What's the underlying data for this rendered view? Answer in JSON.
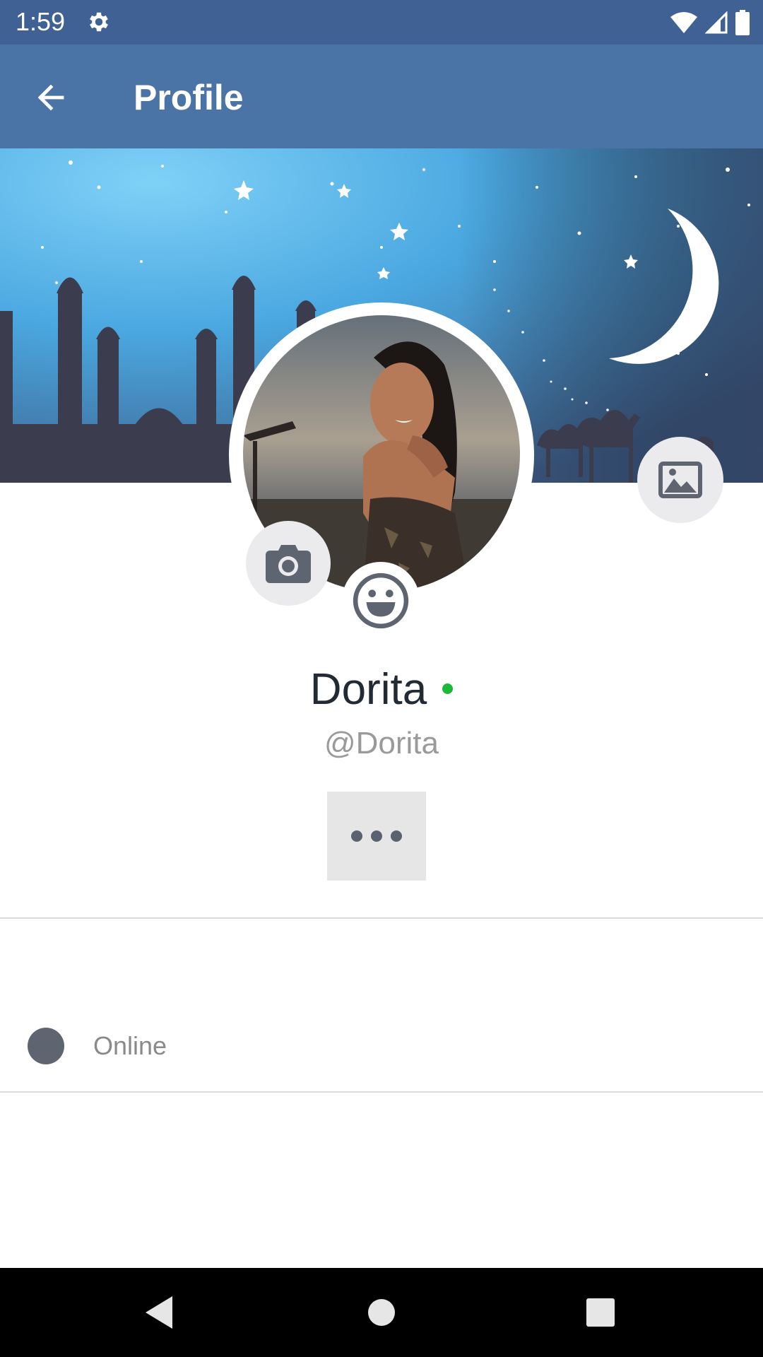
{
  "status_bar": {
    "time": "1:59",
    "icons": [
      "gear-icon",
      "wifi-icon",
      "signal-icon",
      "battery-icon"
    ]
  },
  "app_bar": {
    "title": "Profile",
    "back_icon": "arrow-left-icon"
  },
  "profile": {
    "display_name": "Dorita",
    "username": "@Dorita",
    "presence_color": "#1cb83a",
    "more_icon": "ellipsis-icon",
    "camera_icon": "camera-icon",
    "cover_image_icon": "image-icon",
    "emoji_icon": "smiley-icon"
  },
  "status": {
    "label": "Online"
  },
  "nav_bar": {
    "icons": [
      "back-triangle-icon",
      "home-circle-icon",
      "recents-square-icon"
    ]
  },
  "colors": {
    "status_bar": "#3f6193",
    "app_bar": "#4a73a6",
    "accent_grey": "#5f6570"
  }
}
